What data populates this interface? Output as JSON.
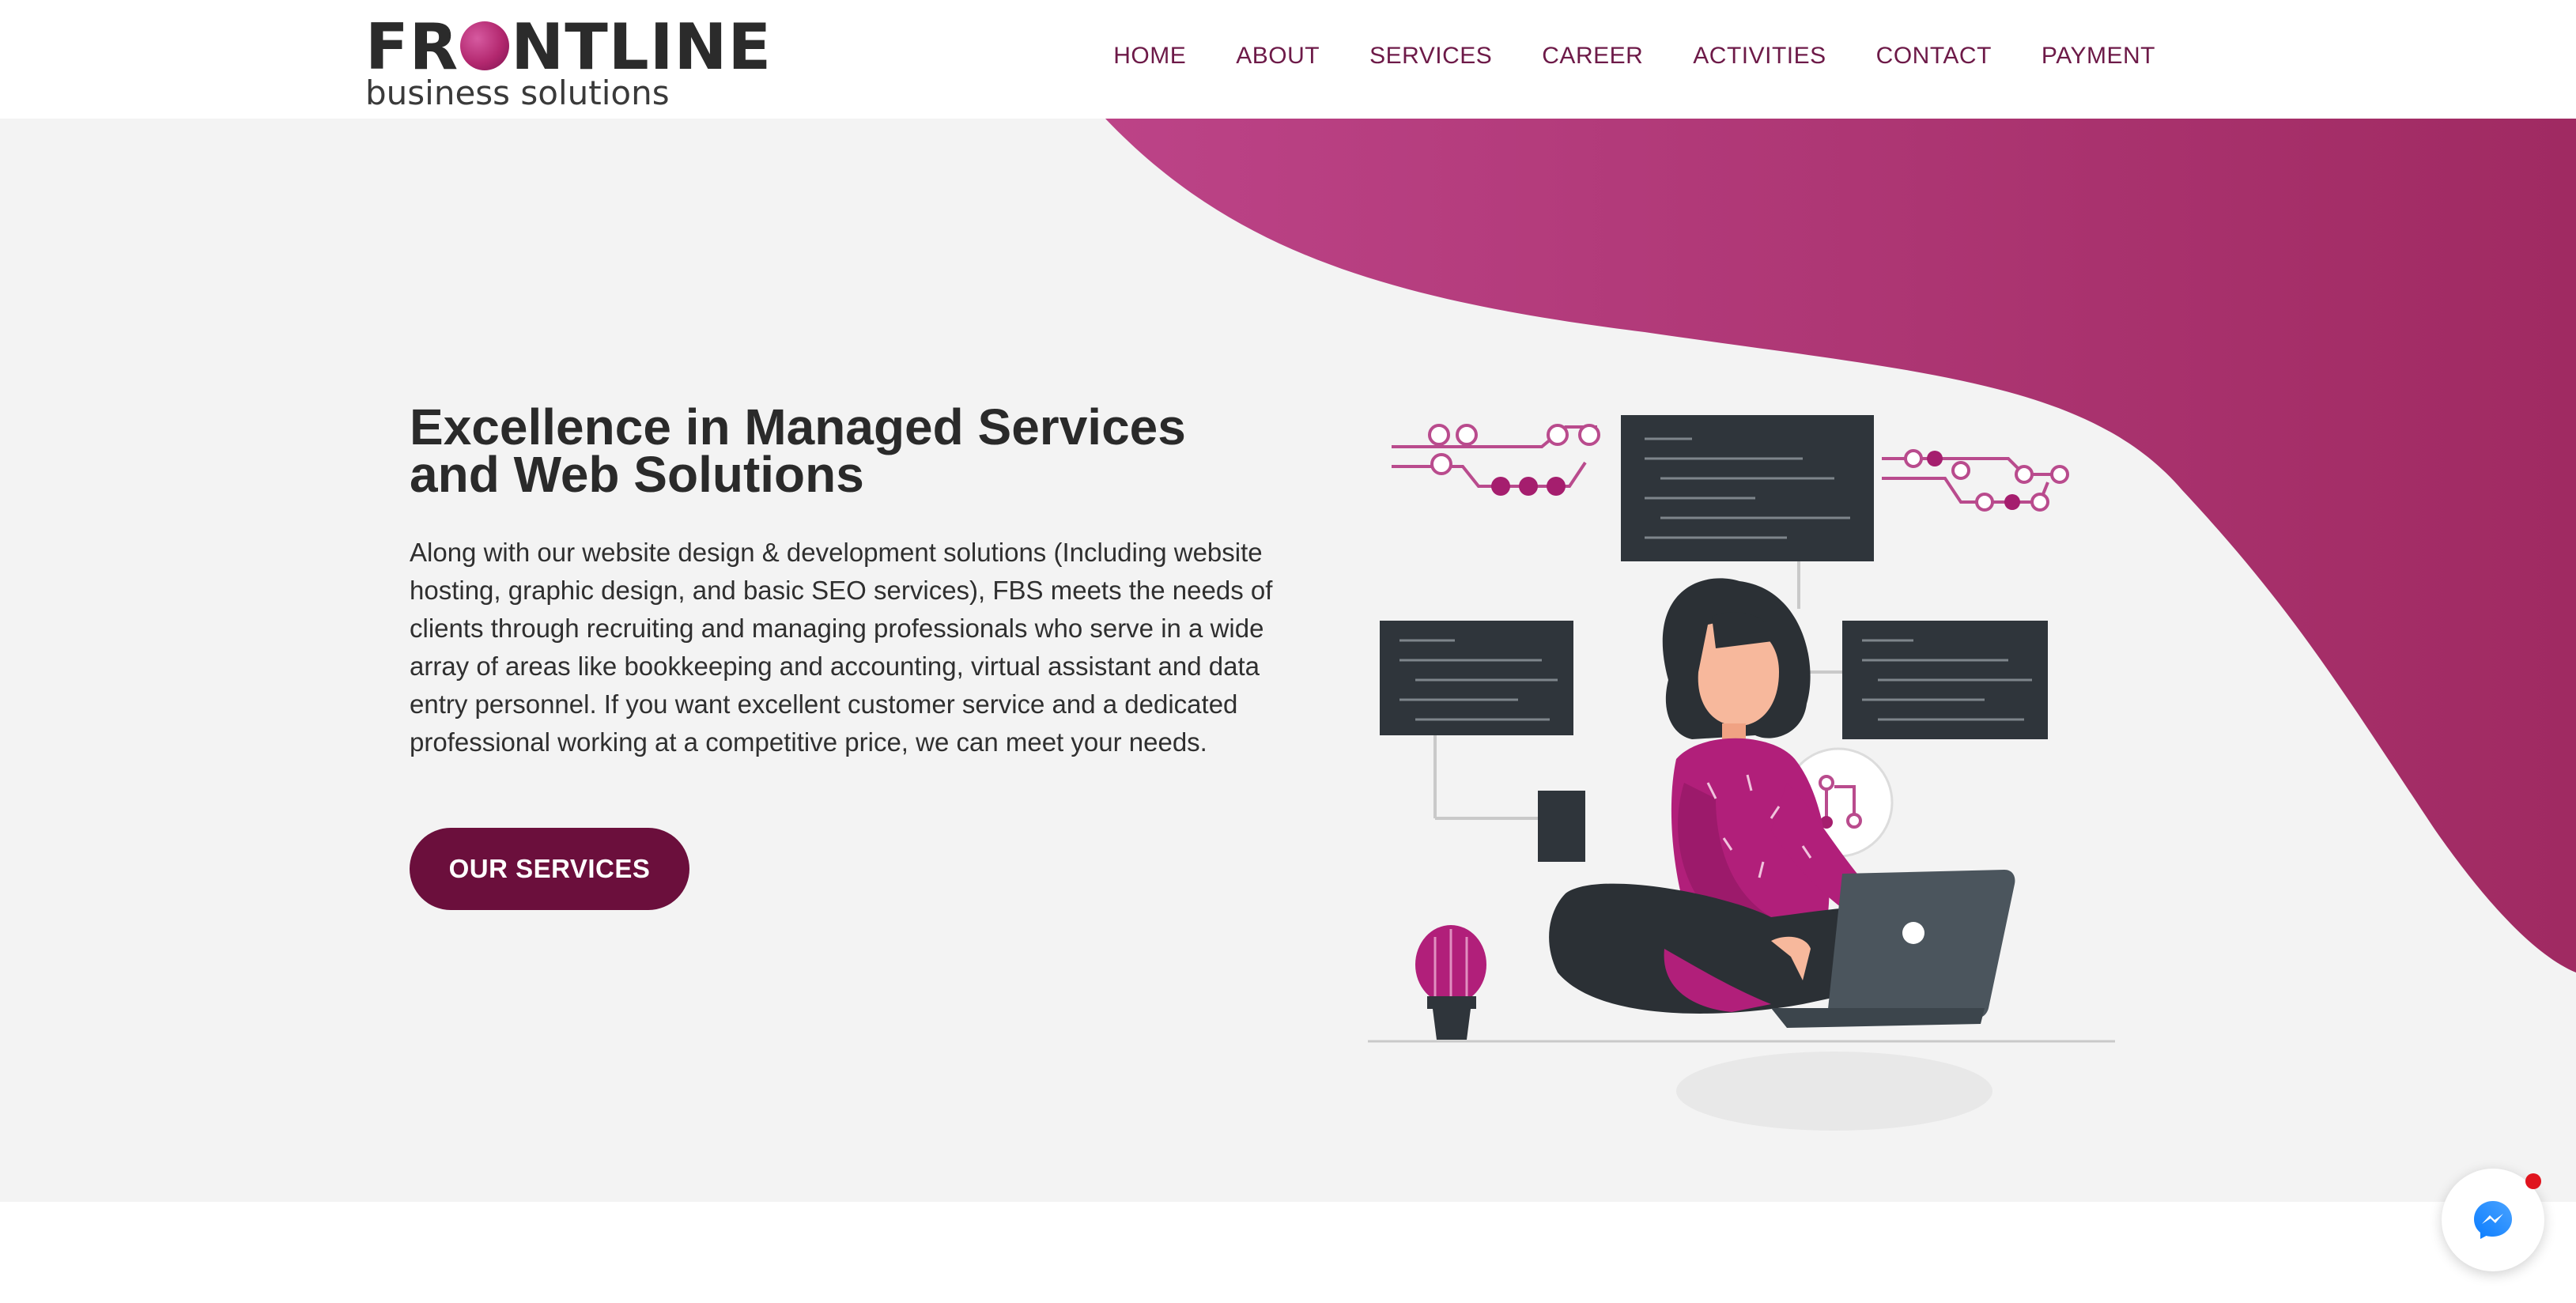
{
  "brand": {
    "logo_top_left": "FR",
    "logo_top_right": "NTLINE",
    "logo_bottom": "business solutions",
    "accent": "#b0307a",
    "dark_accent": "#6b0f3c"
  },
  "nav": {
    "items": [
      {
        "label": "HOME"
      },
      {
        "label": "ABOUT"
      },
      {
        "label": "SERVICES"
      },
      {
        "label": "CAREER"
      },
      {
        "label": "ACTIVITIES"
      },
      {
        "label": "CONTACT"
      },
      {
        "label": "PAYMENT"
      }
    ]
  },
  "hero": {
    "headline_line1_regular": "Excellence in ",
    "headline_line1_bold": "Managed Services",
    "headline_line2_regular": "and ",
    "headline_line2_bold": "Web Solutions",
    "description": "Along with our website design & development solutions (Including website hosting, graphic design, and basic SEO services), FBS meets the needs of clients through recruiting and managing professionals who serve in a wide array of areas like bookkeeping and accounting, virtual assistant and data entry personnel. If you want excellent customer service and a dedicated professional working at a competitive price, we can meet your needs.",
    "cta_label": "OUR SERVICES"
  },
  "icons": {
    "messenger": "messenger-icon",
    "logo_globe": "globe-icon"
  }
}
